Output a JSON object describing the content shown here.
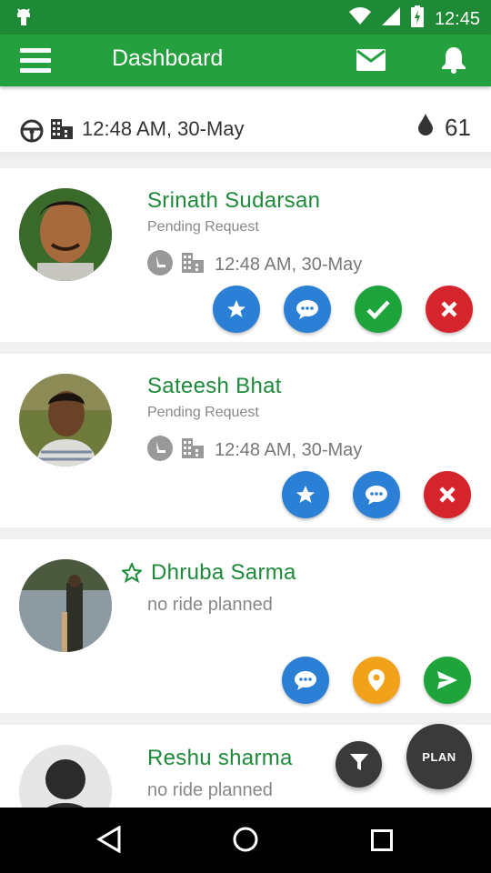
{
  "status_bar": {
    "time": "12:45"
  },
  "toolbar": {
    "title": "Dashboard"
  },
  "summary": {
    "datetime": "12:48 AM, 30-May",
    "count": "61"
  },
  "cards": [
    {
      "name": "Srinath Sudarsan",
      "status": "Pending Request",
      "datetime": "12:48 AM, 30-May",
      "actions": [
        "star",
        "chat",
        "accept",
        "reject"
      ]
    },
    {
      "name": "Sateesh Bhat",
      "status": "Pending Request",
      "datetime": "12:48 AM, 30-May",
      "actions": [
        "star",
        "chat",
        "reject"
      ]
    },
    {
      "name": "Dhruba Sarma",
      "status": "no ride planned",
      "actions": [
        "chat",
        "location",
        "send"
      ]
    },
    {
      "name": "Reshu sharma",
      "status": "no ride planned"
    }
  ],
  "fab": {
    "plan_label": "PLAN"
  },
  "colors": {
    "primary": "#25a03e",
    "status_bar": "#1f8a35",
    "name_text": "#1e8a3a",
    "blue": "#2b7fd4",
    "green": "#1fa43c",
    "red": "#d6242c",
    "orange": "#f1a21a"
  }
}
